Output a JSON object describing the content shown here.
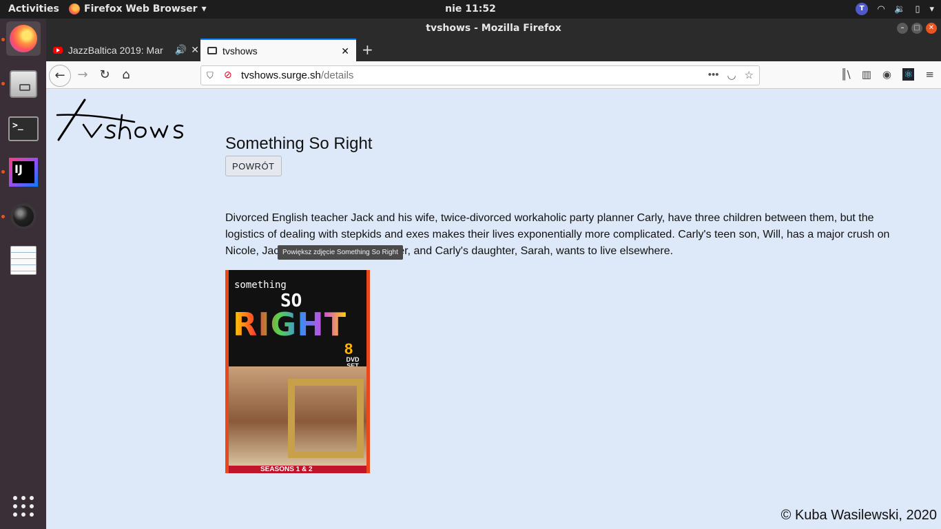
{
  "topbar": {
    "activities": "Activities",
    "app_menu": "Firefox Web Browser",
    "clock": "nie 11:52"
  },
  "window": {
    "title": "tvshows - Mozilla Firefox"
  },
  "tabs": [
    {
      "title": "JazzBaltica 2019: Mar",
      "icon": "youtube-icon",
      "audio": true
    },
    {
      "title": "tvshows",
      "icon": "tv-icon",
      "active": true
    }
  ],
  "url": {
    "host": "tvshows.surge.sh",
    "path": "/details"
  },
  "page": {
    "logo_text": "tvshows",
    "show_title": "Something So Right",
    "back_label": "POWRÓT",
    "summary": "Divorced English teacher Jack and his wife, twice-divorced workaholic party planner Carly, have three children between them, but the logistics of dealing with stepkids and exes makes their lives exponentially more complicated. Carly's teen son, Will, has a major crush on Nicole, Jack's stunning teen daughter, and Carly's daughter, Sarah, wants to live elsewhere.",
    "tooltip": "Powiększ zdjęcie Something So Right",
    "poster": {
      "sub": "something",
      "so": "SO",
      "right": "RIGHT",
      "set_number": "8",
      "set_label": "DVD SET",
      "bottom": "SEASONS 1 & 2"
    },
    "footer": "© Kuba Wasilewski, 2020"
  },
  "colors": {
    "accent": "#e95420",
    "page_bg": "#dde8f8",
    "tab_highlight": "#0a84ff"
  }
}
